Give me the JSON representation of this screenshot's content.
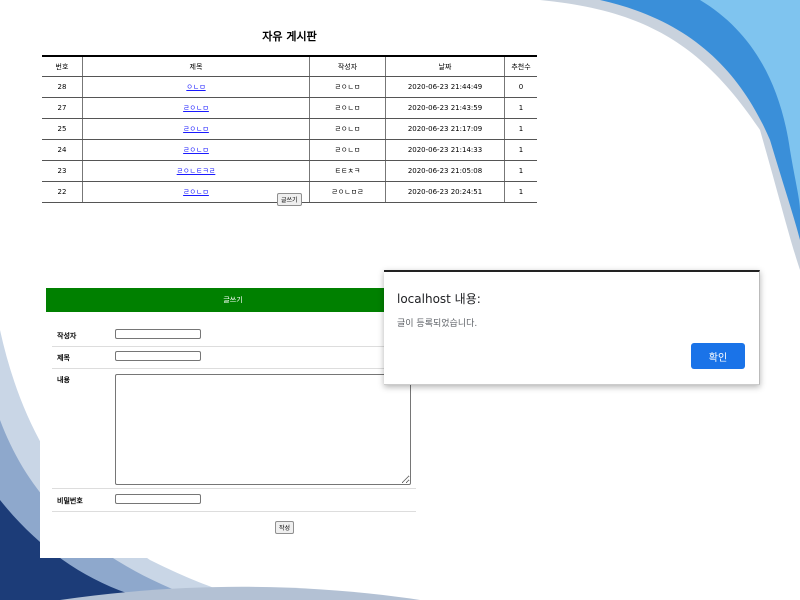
{
  "board": {
    "title": "자유 게시판",
    "columns": [
      "번호",
      "제목",
      "작성자",
      "날짜",
      "추천수"
    ],
    "rows": [
      {
        "no": "28",
        "title": "ㅇㄴㅁ",
        "author": "ㄹㅇㄴㅁ",
        "date": "2020-06-23 21:44:49",
        "likes": "0"
      },
      {
        "no": "27",
        "title": "ㄹㅇㄴㅁ",
        "author": "ㄹㅇㄴㅁ",
        "date": "2020-06-23 21:43:59",
        "likes": "1"
      },
      {
        "no": "25",
        "title": "ㄹㅇㄴㅁ",
        "author": "ㄹㅇㄴㅁ",
        "date": "2020-06-23 21:17:09",
        "likes": "1"
      },
      {
        "no": "24",
        "title": "ㄹㅇㄴㅁ",
        "author": "ㄹㅇㄴㅁ",
        "date": "2020-06-23 21:14:33",
        "likes": "1"
      },
      {
        "no": "23",
        "title": "ㄹㅇㄴㅌㅋㄹ",
        "author": "ㅌㅌㅊㅋ",
        "date": "2020-06-23 21:05:08",
        "likes": "1"
      },
      {
        "no": "22",
        "title": "ㄹㅇㄴㅁ",
        "author": "ㄹㅇㄴㅁㄹ",
        "date": "2020-06-23 20:24:51",
        "likes": "1"
      }
    ],
    "write_button": "글쓰기"
  },
  "form": {
    "header": "글쓰기",
    "author_label": "작성자",
    "title_label": "제목",
    "content_label": "내용",
    "password_label": "비밀번호",
    "author_value": "",
    "title_value": "",
    "content_value": "",
    "password_value": "",
    "submit_button": "작성"
  },
  "dialog": {
    "title": "localhost 내용:",
    "message": "글이 등록되었습니다.",
    "ok_button": "확인"
  },
  "colors": {
    "form_header": "#008000",
    "dialog_button": "#1a73e8",
    "link": "#1a1aff",
    "wave_blue": "#3a8fd9",
    "wave_navy": "#1c3c78",
    "wave_gray": "#c9d2dd"
  }
}
